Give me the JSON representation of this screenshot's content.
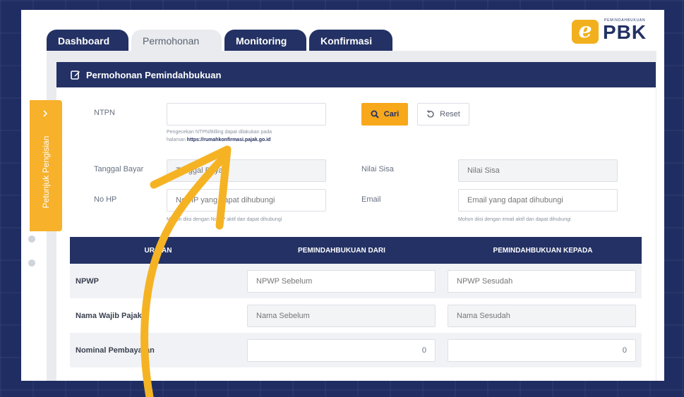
{
  "tabs": [
    {
      "label": "Dashboard",
      "active": false
    },
    {
      "label": "Permohonan",
      "active": true
    },
    {
      "label": "Monitoring",
      "active": false
    },
    {
      "label": "Konfirmasi",
      "active": false
    }
  ],
  "logo": {
    "small": "PEMINDAHBUKUAN",
    "text": "PBK",
    "letter": "e"
  },
  "side_tab": {
    "label": "Petunjuk Pengisian",
    "icon": "chevron-right-icon"
  },
  "panel": {
    "title": "Permohonan Pemindahbukuan",
    "title_icon": "edit-icon"
  },
  "form": {
    "ntpn_label": "NTPN",
    "ntpn_value": "",
    "ntpn_hint_line1": "Pengecekan NTPN/Billing dapat dilakukan pada",
    "ntpn_hint_prefix": "halaman ",
    "ntpn_hint_link": "https://rumahkonfirmasi.pajak.go.id",
    "cari_label": "Cari",
    "reset_label": "Reset",
    "tanggal_label": "Tanggal Bayar",
    "tanggal_placeholder": "Tanggal Bayar",
    "nilai_sisa_label": "Nilai Sisa",
    "nilai_sisa_placeholder": "Nilai Sisa",
    "nohp_label": "No HP",
    "nohp_placeholder": "No HP yang dapat dihubungi",
    "nohp_hint": "Mohon diisi dengan No HP aktif dan dapat dihubungi",
    "email_label": "Email",
    "email_placeholder": "Email yang dapat dihubungi",
    "email_hint": "Mohon diisi dengan email aktif dan dapat dihubungi"
  },
  "table": {
    "headers": [
      "URAIAN",
      "PEMINDAHBUKUAN DARI",
      "PEMINDAHBUKUAN KEPADA"
    ],
    "rows": [
      {
        "label": "NPWP",
        "from_placeholder": "NPWP Sebelum",
        "to_placeholder": "NPWP Sesudah"
      },
      {
        "label": "Nama Wajib Pajak",
        "from_placeholder": "Nama Sebelum",
        "to_placeholder": "Nama Sesudah"
      },
      {
        "label": "Nominal Pembayaran",
        "from_value": "0",
        "to_value": "0"
      }
    ]
  },
  "colors": {
    "navy": "#233164",
    "accent": "#f7a81b",
    "annotation_arrow": "#f5b324"
  }
}
